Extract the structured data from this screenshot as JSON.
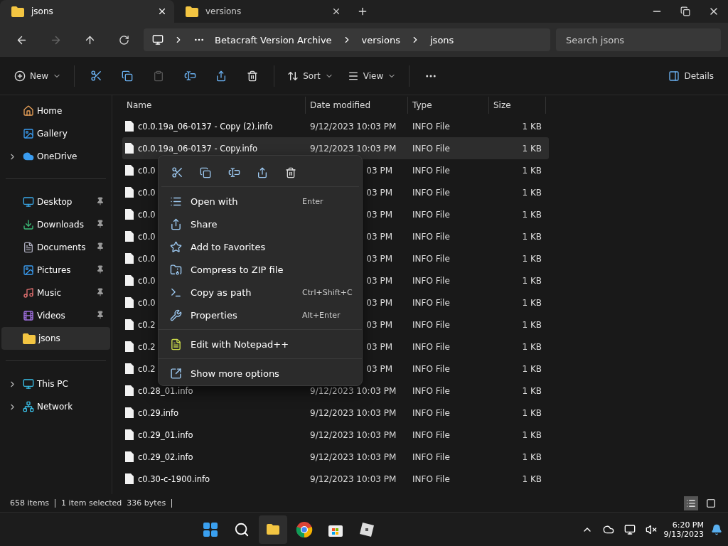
{
  "tabs": [
    {
      "label": "jsons",
      "selected": true
    },
    {
      "label": "versions",
      "selected": false
    }
  ],
  "address": {
    "crumbs": [
      "Betacraft Version Archive",
      "versions",
      "jsons"
    ],
    "search_placeholder": "Search jsons"
  },
  "commands": {
    "new": "New",
    "sort": "Sort",
    "view": "View",
    "details": "Details"
  },
  "sidebar": {
    "groups": [
      [
        {
          "label": "Home",
          "expandable": false,
          "pinned": false,
          "selected": false
        },
        {
          "label": "Gallery",
          "expandable": false,
          "pinned": false,
          "selected": false
        },
        {
          "label": "OneDrive",
          "expandable": true,
          "pinned": false,
          "selected": false
        }
      ],
      [
        {
          "label": "Desktop",
          "expandable": false,
          "pinned": true,
          "selected": false
        },
        {
          "label": "Downloads",
          "expandable": false,
          "pinned": true,
          "selected": false
        },
        {
          "label": "Documents",
          "expandable": false,
          "pinned": true,
          "selected": false
        },
        {
          "label": "Pictures",
          "expandable": false,
          "pinned": true,
          "selected": false
        },
        {
          "label": "Music",
          "expandable": false,
          "pinned": true,
          "selected": false
        },
        {
          "label": "Videos",
          "expandable": false,
          "pinned": true,
          "selected": false
        },
        {
          "label": "jsons",
          "expandable": false,
          "pinned": false,
          "selected": true
        }
      ],
      [
        {
          "label": "This PC",
          "expandable": true,
          "pinned": false,
          "selected": false
        },
        {
          "label": "Network",
          "expandable": true,
          "pinned": false,
          "selected": false
        }
      ]
    ]
  },
  "table": {
    "columns": [
      "Name",
      "Date modified",
      "Type",
      "Size"
    ],
    "rows": [
      {
        "kind": "full",
        "name": "c0.0.19a_06-0137 - Copy (2).info",
        "date": "9/12/2023 10:03 PM",
        "type": "INFO File",
        "size": "1 KB",
        "selected": false
      },
      {
        "kind": "full",
        "name": "c0.0.19a_06-0137 - Copy.info",
        "date": "9/12/2023 10:03 PM",
        "type": "INFO File",
        "size": "1 KB",
        "selected": true
      },
      {
        "kind": "covered",
        "name": "c0.0",
        "date": "03 PM",
        "type": "INFO File",
        "size": "1 KB",
        "selected": false
      },
      {
        "kind": "covered",
        "name": "c0.0",
        "date": "03 PM",
        "type": "INFO File",
        "size": "1 KB",
        "selected": false
      },
      {
        "kind": "covered",
        "name": "c0.0",
        "date": "03 PM",
        "type": "INFO File",
        "size": "1 KB",
        "selected": false
      },
      {
        "kind": "covered",
        "name": "c0.0",
        "date": "03 PM",
        "type": "INFO File",
        "size": "1 KB",
        "selected": false
      },
      {
        "kind": "covered",
        "name": "c0.0",
        "date": "03 PM",
        "type": "INFO File",
        "size": "1 KB",
        "selected": false
      },
      {
        "kind": "covered",
        "name": "c0.0",
        "date": "03 PM",
        "type": "INFO File",
        "size": "1 KB",
        "selected": false
      },
      {
        "kind": "covered",
        "name": "c0.0",
        "date": "03 PM",
        "type": "INFO File",
        "size": "1 KB",
        "selected": false
      },
      {
        "kind": "covered",
        "name": "c0.2",
        "date": "03 PM",
        "type": "INFO File",
        "size": "1 KB",
        "selected": false
      },
      {
        "kind": "covered",
        "name": "c0.2",
        "date": "03 PM",
        "type": "INFO File",
        "size": "1 KB",
        "selected": false
      },
      {
        "kind": "covered",
        "name": "c0.2",
        "date": "03 PM",
        "type": "INFO File",
        "size": "1 KB",
        "selected": false
      },
      {
        "kind": "full",
        "name": "c0.28_01.info",
        "date": "9/12/2023 10:03 PM",
        "type": "INFO File",
        "size": "1 KB",
        "selected": false
      },
      {
        "kind": "full",
        "name": "c0.29.info",
        "date": "9/12/2023 10:03 PM",
        "type": "INFO File",
        "size": "1 KB",
        "selected": false
      },
      {
        "kind": "full",
        "name": "c0.29_01.info",
        "date": "9/12/2023 10:03 PM",
        "type": "INFO File",
        "size": "1 KB",
        "selected": false
      },
      {
        "kind": "full",
        "name": "c0.29_02.info",
        "date": "9/12/2023 10:03 PM",
        "type": "INFO File",
        "size": "1 KB",
        "selected": false
      },
      {
        "kind": "full",
        "name": "c0.30-c-1900.info",
        "date": "9/12/2023 10:03 PM",
        "type": "INFO File",
        "size": "1 KB",
        "selected": false
      }
    ]
  },
  "context_menu": {
    "items": [
      {
        "kind": "item",
        "label": "Open with",
        "shortcut": "Enter"
      },
      {
        "kind": "item",
        "label": "Share"
      },
      {
        "kind": "item",
        "label": "Add to Favorites"
      },
      {
        "kind": "item",
        "label": "Compress to ZIP file"
      },
      {
        "kind": "item",
        "label": "Copy as path",
        "shortcut": "Ctrl+Shift+C"
      },
      {
        "kind": "item",
        "label": "Properties",
        "shortcut": "Alt+Enter"
      },
      {
        "kind": "separator"
      },
      {
        "kind": "item",
        "label": "Edit with Notepad++"
      },
      {
        "kind": "separator"
      },
      {
        "kind": "item",
        "label": "Show more options"
      }
    ]
  },
  "status_bar": {
    "count": "658 items",
    "selection": "1 item selected  336 bytes"
  },
  "taskbar": {
    "time": "6:20 PM",
    "date": "9/13/2023"
  }
}
